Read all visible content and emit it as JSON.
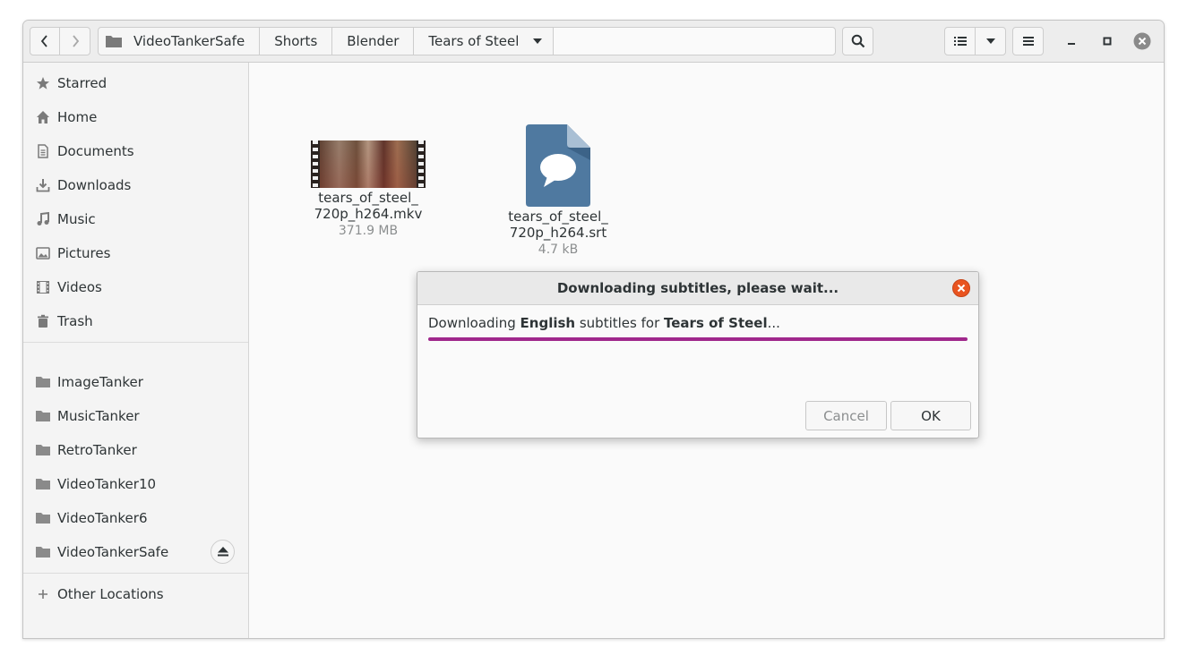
{
  "header": {
    "back_icon": "chevron-left-icon",
    "forward_icon": "chevron-right-icon",
    "breadcrumbs": [
      "VideoTankerSafe",
      "Shorts",
      "Blender",
      "Tears of Steel"
    ],
    "search_icon": "search-icon",
    "view_icon": "list-view-icon",
    "menu_icon": "hamburger-icon"
  },
  "sidebar": {
    "items": [
      {
        "label": "Starred",
        "icon": "star-icon"
      },
      {
        "label": "Home",
        "icon": "home-icon"
      },
      {
        "label": "Documents",
        "icon": "document-icon"
      },
      {
        "label": "Downloads",
        "icon": "download-icon"
      },
      {
        "label": "Music",
        "icon": "music-icon"
      },
      {
        "label": "Pictures",
        "icon": "picture-icon"
      },
      {
        "label": "Videos",
        "icon": "video-icon"
      },
      {
        "label": "Trash",
        "icon": "trash-icon"
      }
    ],
    "drives": [
      "ImageTanker",
      "MusicTanker",
      "RetroTanker",
      "VideoTanker10",
      "VideoTanker6",
      "VideoTankerSafe"
    ],
    "other_locations": "Other Locations"
  },
  "files": [
    {
      "name_line1": "tears_of_steel_",
      "name_line2": "720p_h264.mkv",
      "size": "371.9 MB"
    },
    {
      "name_line1": "tears_of_steel_",
      "name_line2": "720p_h264.srt",
      "size": "4.7 kB"
    }
  ],
  "dialog": {
    "title": "Downloading subtitles, please wait...",
    "msg_prefix": "Downloading ",
    "language": "English",
    "msg_middle": " subtitles for ",
    "movie": "Tears of Steel",
    "msg_suffix": "...",
    "progress": 1.0,
    "cancel_label": "Cancel",
    "ok_label": "OK"
  },
  "colors": {
    "accent_progress": "#a0288c",
    "close_button": "#e95420",
    "srt_icon": "#4f79a0"
  }
}
